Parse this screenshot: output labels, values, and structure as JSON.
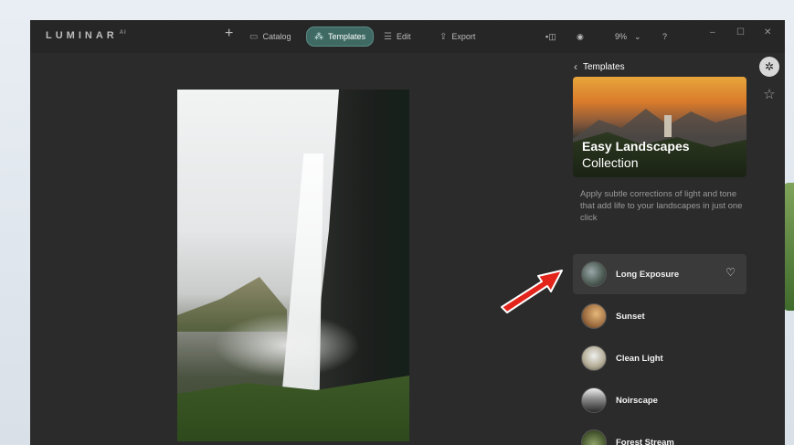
{
  "app": {
    "logo": "LUMINAR",
    "logo_sup": "AI"
  },
  "toolbar": {
    "add_icon": "plus-icon",
    "tabs": [
      {
        "label": "Catalog",
        "icon": "folder-icon"
      },
      {
        "label": "Templates",
        "icon": "wand-icon",
        "active": true
      },
      {
        "label": "Edit",
        "icon": "sliders-icon"
      },
      {
        "label": "Export",
        "icon": "export-icon"
      }
    ],
    "zoom": "9%",
    "icons": [
      "compare-icon",
      "eye-icon",
      "help-icon"
    ]
  },
  "window_controls": {
    "minimize": "–",
    "maximize": "☐",
    "close": "✕"
  },
  "panel": {
    "back_label": "Templates",
    "collection_title": "Easy Landscapes",
    "collection_subtitle": "Collection",
    "description": "Apply subtle corrections of light and tone that add life to your landscapes in just one click",
    "templates": [
      {
        "name": "Long Exposure",
        "selected": true
      },
      {
        "name": "Sunset"
      },
      {
        "name": "Clean Light"
      },
      {
        "name": "Noirscape"
      },
      {
        "name": "Forest Stream"
      }
    ]
  },
  "colors": {
    "accent": "#3f6a64",
    "window_bg": "#2b2b2b",
    "arrow": "#e3241b"
  }
}
